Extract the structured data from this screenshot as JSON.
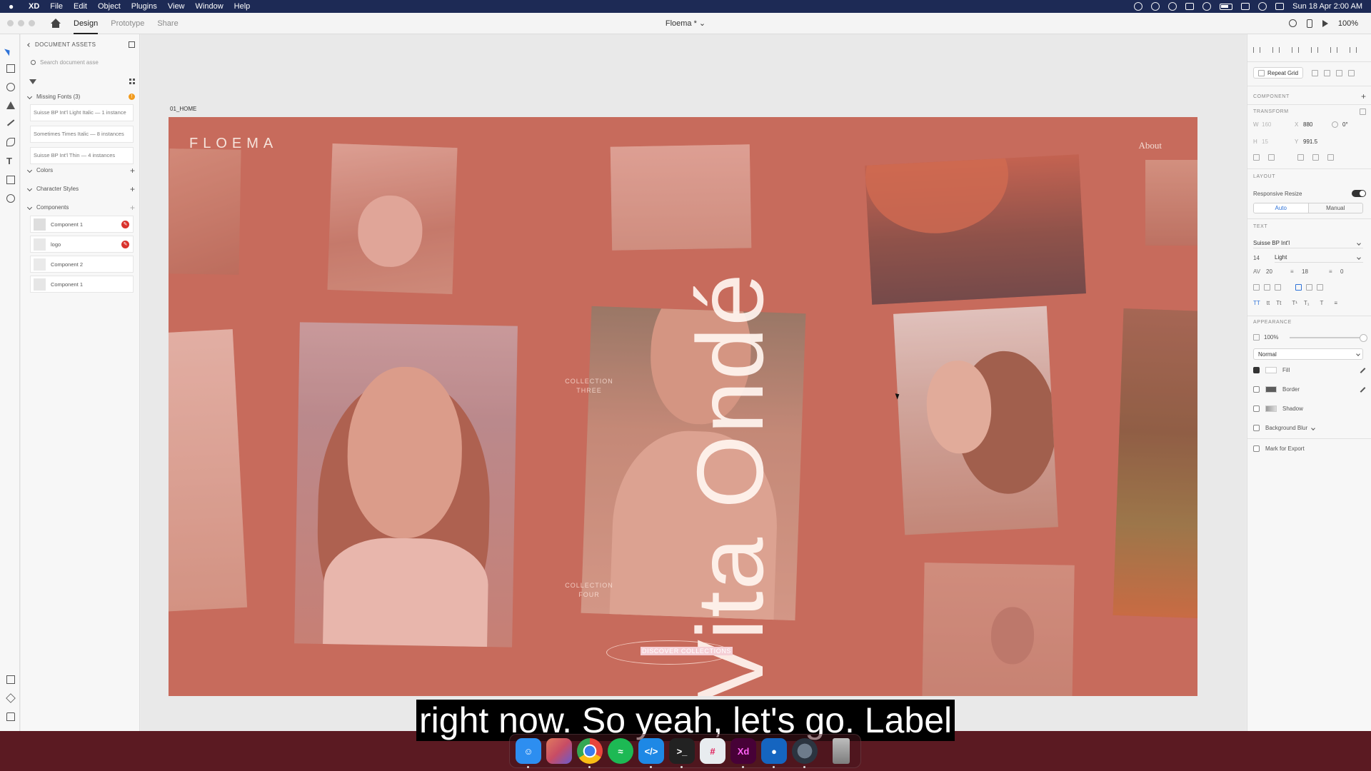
{
  "menubar": {
    "app_name": "XD",
    "items": [
      "File",
      "Edit",
      "Object",
      "Plugins",
      "View",
      "Window",
      "Help"
    ],
    "datetime": "Sun 18 Apr  2:00 AM"
  },
  "titlebar": {
    "tabs": [
      "Design",
      "Prototype",
      "Share"
    ],
    "document_title": "Floema * ⌄",
    "zoom": "100%"
  },
  "assets": {
    "header": "DOCUMENT ASSETS",
    "search_placeholder": "Search document asse",
    "missing_fonts_label": "Missing Fonts (3)",
    "missing_fonts": [
      "Suisse BP Int'l Light Italic — 1 instance",
      "Sometimes Times Italic — 8 instances",
      "Suisse BP Int'l Thin — 4 instances"
    ],
    "colors_label": "Colors",
    "character_styles_label": "Character Styles",
    "components_label": "Components",
    "components": [
      {
        "label": "Component 1"
      },
      {
        "label": "logo"
      },
      {
        "label": "Component 2"
      },
      {
        "label": "Component 1"
      }
    ]
  },
  "canvas": {
    "artboard_name": "01_HOME",
    "logo_text": "FLOEMA",
    "about_link": "About",
    "hero_title": "Vita Ondé",
    "collection_three": [
      "COLLECTION",
      "THREE"
    ],
    "collection_four": [
      "COLLECTION",
      "FOUR"
    ],
    "cta": "DISCOVER COLLECTIONS"
  },
  "properties": {
    "repeat_grid": "Repeat Grid",
    "component_section": "COMPONENT",
    "transform_section": "TRANSFORM",
    "w_label": "W",
    "w_value": "160",
    "h_label": "H",
    "h_value": "15",
    "x_label": "X",
    "x_value": "880",
    "y_label": "Y",
    "y_value": "991.5",
    "rotation": "0°",
    "layout_section": "LAYOUT",
    "responsive_resize": "Responsive Resize",
    "layout_auto": "Auto",
    "layout_manual": "Manual",
    "text_section": "TEXT",
    "font_family": "Suisse BP Int'l",
    "font_size": "14",
    "font_weight": "Light",
    "char_spacing": "20",
    "line_spacing": "18",
    "paragraph_spacing": "0",
    "appearance_section": "APPEARANCE",
    "opacity": "100%",
    "blend_mode": "Normal",
    "fill_label": "Fill",
    "border_label": "Border",
    "shadow_label": "Shadow",
    "background_blur_label": "Background Blur",
    "mark_for_export": "Mark for Export",
    "colors": {
      "fill": "#ffffff",
      "border": "#5c5c5c",
      "accent": "#2f73d8"
    }
  },
  "subtitle": "right now. So yeah, let's go. Label",
  "dock": {
    "apps": [
      {
        "name": "finder-icon",
        "color": "#2d8ef0"
      },
      {
        "name": "launchpad-icon",
        "color": "#c84c64"
      },
      {
        "name": "chrome-icon",
        "color": "#e8453c"
      },
      {
        "name": "spotify-icon",
        "color": "#1db954"
      },
      {
        "name": "vscode-icon",
        "color": "#1e88e5"
      },
      {
        "name": "terminal-icon",
        "color": "#222222"
      },
      {
        "name": "slack-icon",
        "color": "#e8ecef"
      },
      {
        "name": "xd-icon",
        "color": "#470137"
      },
      {
        "name": "maps-icon",
        "color": "#1565c0"
      },
      {
        "name": "quicktime-icon",
        "color": "#6d7b8b"
      },
      {
        "name": "trash-icon",
        "color": "#8f8f8f"
      }
    ]
  }
}
